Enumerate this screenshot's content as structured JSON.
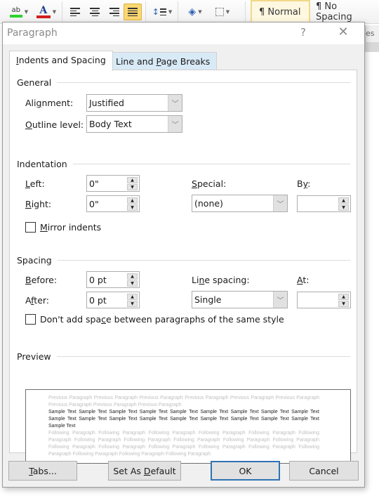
{
  "ribbon": {
    "highlight_color": "#2fd12f",
    "font_color": "#d41c1c",
    "text_highlight_label": "ab",
    "font_color_label": "A",
    "styles": [
      {
        "label": "¶ Normal",
        "selected": true
      },
      {
        "label": "¶ No Spacing",
        "selected": false
      }
    ],
    "behind_tab_text": "es"
  },
  "dialog": {
    "title": "Paragraph",
    "help_label": "?",
    "close_label": "✕",
    "tabs": [
      {
        "label_pre": "",
        "label_u": "I",
        "label_post": "ndents and Spacing",
        "active": true
      },
      {
        "label_pre": "Line and ",
        "label_u": "P",
        "label_post": "age Breaks",
        "active": false
      }
    ],
    "general": {
      "heading": "General",
      "alignment_label_pre": "Ali",
      "alignment_label_u": "g",
      "alignment_label_post": "nment:",
      "alignment_value": "Justified",
      "outline_label_u": "O",
      "outline_label_post": "utline level:",
      "outline_value": "Body Text"
    },
    "indentation": {
      "heading": "Indentation",
      "left_label_u": "L",
      "left_label_post": "eft:",
      "left_value": "0\"",
      "right_label_u": "R",
      "right_label_post": "ight:",
      "right_value": "0\"",
      "special_label_u": "S",
      "special_label_post": "pecial:",
      "special_value": "(none)",
      "by_label_pre": "B",
      "by_label_u": "y",
      "by_label_post": ":",
      "by_value": "",
      "mirror_label_u": "M",
      "mirror_label_post": "irror indents",
      "mirror_checked": false
    },
    "spacing": {
      "heading": "Spacing",
      "before_label_u": "B",
      "before_label_post": "efore:",
      "before_value": "0 pt",
      "after_label_pre": "A",
      "after_label_u": "f",
      "after_label_post": "ter:",
      "after_value": "0 pt",
      "line_spacing_label_pre": "Li",
      "line_spacing_label_u": "n",
      "line_spacing_label_post": "e spacing:",
      "line_spacing_value": "Single",
      "at_label_u": "A",
      "at_label_post": "t:",
      "at_value": "",
      "dont_add_label_pre": "Don't add spa",
      "dont_add_label_u": "c",
      "dont_add_label_post": "e between paragraphs of the same style",
      "dont_add_checked": false
    },
    "preview": {
      "heading": "Preview",
      "previous_text": "Previous Paragraph Previous Paragraph Previous Paragraph Previous Paragraph Previous Paragraph Previous Paragraph Previous Paragraph Previous Paragraph Previous Paragraph",
      "sample_text": "Sample Text Sample Text Sample Text Sample Text Sample Text Sample Text Sample Text Sample Text Sample Text Sample Text Sample Text Sample Text Sample Text Sample Text Sample Text Sample Text Sample Text Sample Text Sample Text",
      "following_text": "Following Paragraph Following Paragraph Following Paragraph Following Paragraph Following Paragraph Following Paragraph Following Paragraph Following Paragraph Following Paragraph Following Paragraph Following Paragraph Following Paragraph Following Paragraph Following Paragraph Following Paragraph Following Paragraph Following Paragraph Following Paragraph Following Paragraph Following Paragraph"
    },
    "buttons": {
      "tabs_u": "T",
      "tabs_post": "abs...",
      "default_pre": "Set As ",
      "default_u": "D",
      "default_post": "efault",
      "ok": "OK",
      "cancel": "Cancel"
    }
  }
}
